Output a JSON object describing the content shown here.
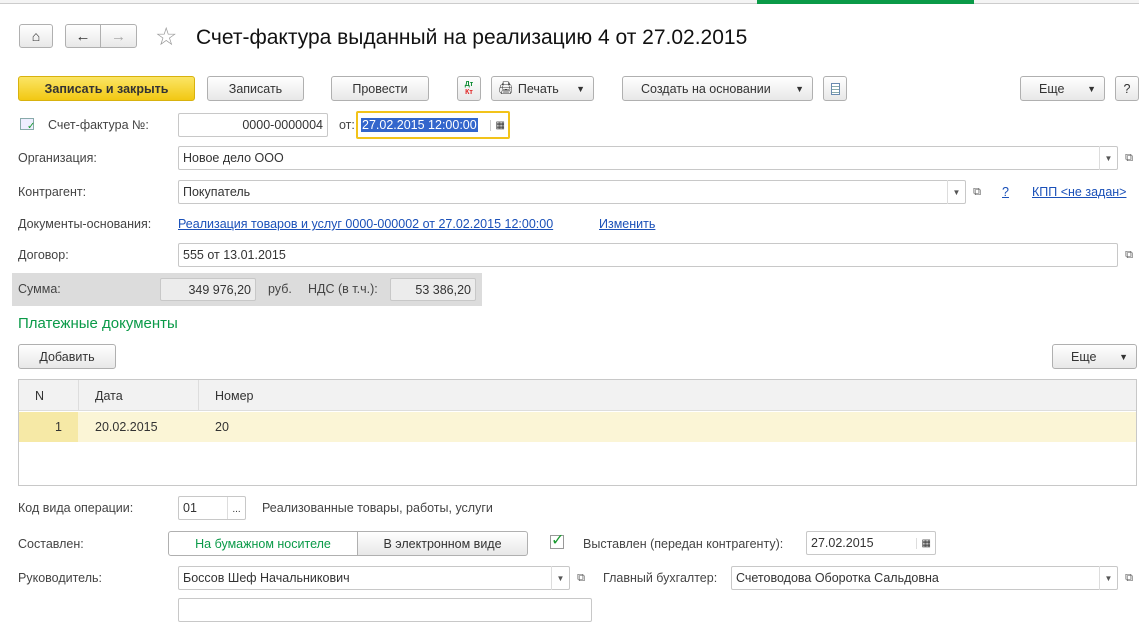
{
  "title": "Счет-фактура выданный на реализацию 4 от 27.02.2015",
  "toolbar": {
    "save_close": "Записать и закрыть",
    "save": "Записать",
    "post": "Провести",
    "dtkt_dt": "Дт",
    "dtkt_kt": "Кт",
    "print": "Печать",
    "create_based": "Создать на основании",
    "more": "Еще",
    "help": "?"
  },
  "header": {
    "invoice_label": "Счет-фактура №:",
    "invoice_number": "0000-0000004",
    "date_label": "от:",
    "date_value": "27.02.2015 12:00:00",
    "org_label": "Организация:",
    "org_value": "Новое дело ООО",
    "counterparty_label": "Контрагент:",
    "counterparty_value": "Покупатель",
    "help": "?",
    "kpp_link": "КПП <не задан>",
    "basis_label": "Документы-основания:",
    "basis_link": "Реализация товаров и услуг 0000-000002 от 27.02.2015 12:00:00",
    "change_link": "Изменить",
    "contract_label": "Договор:",
    "contract_value": "555 от 13.01.2015"
  },
  "totals": {
    "sum_label": "Сумма:",
    "sum_value": "349 976,20",
    "currency": "руб.",
    "vat_label": "НДС (в т.ч.):",
    "vat_value": "53 386,20"
  },
  "payments": {
    "heading": "Платежные документы",
    "add": "Добавить",
    "more": "Еще",
    "columns": [
      "N",
      "Дата",
      "Номер"
    ],
    "rows": [
      {
        "n": "1",
        "date": "20.02.2015",
        "number": "20"
      }
    ]
  },
  "footer": {
    "op_code_label": "Код вида операции:",
    "op_code_value": "01",
    "op_code_desc": "Реализованные товары, работы, услуги",
    "composed_label": "Составлен:",
    "paper": "На бумажном носителе",
    "electronic": "В электронном виде",
    "issued_label": "Выставлен (передан контрагенту):",
    "issued_date": "27.02.2015",
    "issued_checked": true,
    "head_label": "Руководитель:",
    "head_value": "Боссов Шеф Начальникович",
    "accountant_label": "Главный бухгалтер:",
    "accountant_value": "Счетоводова Оборотка Сальдовна"
  },
  "colors": {
    "accent_yellow": "#f5d41f",
    "green": "#0a9a48",
    "link": "#1a50b8",
    "row_highlight": "#fbf5d6"
  }
}
